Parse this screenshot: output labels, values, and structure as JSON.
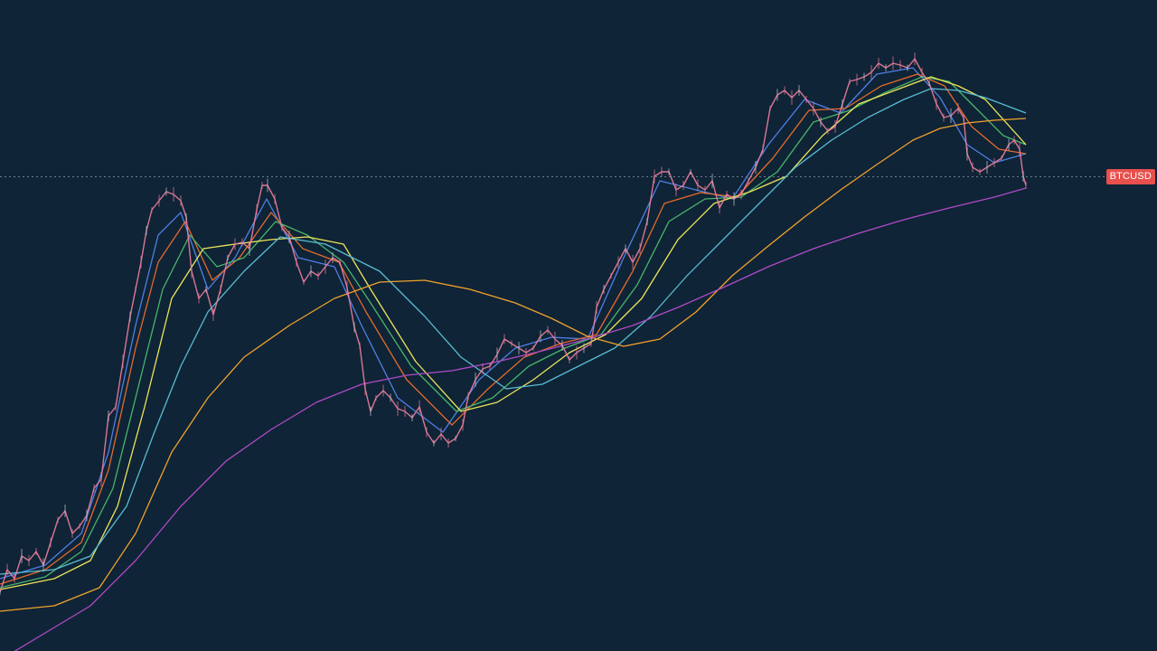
{
  "symbol_label": "BTCUSD",
  "background": "#0f2436",
  "price_line_color": "#6b7d8c",
  "label_color": "#e8504d",
  "chart_data": {
    "type": "line",
    "grid": false,
    "legend": "none",
    "price_color": "#ef7fa0",
    "price": [
      [
        0,
        655
      ],
      [
        8,
        630
      ],
      [
        16,
        640
      ],
      [
        24,
        615
      ],
      [
        32,
        620
      ],
      [
        40,
        610
      ],
      [
        48,
        625
      ],
      [
        56,
        600
      ],
      [
        64,
        575
      ],
      [
        72,
        565
      ],
      [
        80,
        590
      ],
      [
        88,
        582
      ],
      [
        96,
        570
      ],
      [
        104,
        540
      ],
      [
        112,
        530
      ],
      [
        120,
        460
      ],
      [
        128,
        450
      ],
      [
        136,
        400
      ],
      [
        144,
        350
      ],
      [
        150,
        320
      ],
      [
        156,
        290
      ],
      [
        162,
        255
      ],
      [
        168,
        232
      ],
      [
        176,
        222
      ],
      [
        184,
        212
      ],
      [
        192,
        215
      ],
      [
        200,
        222
      ],
      [
        206,
        240
      ],
      [
        212,
        300
      ],
      [
        220,
        330
      ],
      [
        228,
        320
      ],
      [
        236,
        348
      ],
      [
        244,
        320
      ],
      [
        252,
        285
      ],
      [
        260,
        270
      ],
      [
        268,
        268
      ],
      [
        276,
        275
      ],
      [
        284,
        232
      ],
      [
        290,
        205
      ],
      [
        296,
        205
      ],
      [
        304,
        220
      ],
      [
        312,
        252
      ],
      [
        320,
        262
      ],
      [
        328,
        290
      ],
      [
        336,
        312
      ],
      [
        344,
        300
      ],
      [
        352,
        305
      ],
      [
        360,
        295
      ],
      [
        368,
        285
      ],
      [
        376,
        290
      ],
      [
        384,
        318
      ],
      [
        392,
        362
      ],
      [
        398,
        382
      ],
      [
        404,
        430
      ],
      [
        410,
        455
      ],
      [
        416,
        440
      ],
      [
        424,
        432
      ],
      [
        432,
        440
      ],
      [
        440,
        452
      ],
      [
        448,
        455
      ],
      [
        456,
        462
      ],
      [
        464,
        450
      ],
      [
        472,
        478
      ],
      [
        480,
        490
      ],
      [
        488,
        480
      ],
      [
        496,
        490
      ],
      [
        504,
        485
      ],
      [
        512,
        470
      ],
      [
        518,
        438
      ],
      [
        526,
        420
      ],
      [
        534,
        408
      ],
      [
        542,
        405
      ],
      [
        550,
        392
      ],
      [
        558,
        375
      ],
      [
        566,
        380
      ],
      [
        574,
        385
      ],
      [
        582,
        390
      ],
      [
        590,
        385
      ],
      [
        598,
        372
      ],
      [
        606,
        365
      ],
      [
        614,
        375
      ],
      [
        622,
        382
      ],
      [
        630,
        398
      ],
      [
        638,
        390
      ],
      [
        646,
        385
      ],
      [
        654,
        380
      ],
      [
        660,
        340
      ],
      [
        668,
        320
      ],
      [
        676,
        305
      ],
      [
        684,
        290
      ],
      [
        692,
        275
      ],
      [
        700,
        290
      ],
      [
        708,
        275
      ],
      [
        716,
        245
      ],
      [
        724,
        195
      ],
      [
        732,
        190
      ],
      [
        740,
        190
      ],
      [
        748,
        210
      ],
      [
        756,
        205
      ],
      [
        764,
        190
      ],
      [
        772,
        205
      ],
      [
        780,
        210
      ],
      [
        788,
        200
      ],
      [
        796,
        230
      ],
      [
        804,
        215
      ],
      [
        812,
        220
      ],
      [
        820,
        215
      ],
      [
        828,
        200
      ],
      [
        836,
        185
      ],
      [
        844,
        165
      ],
      [
        852,
        120
      ],
      [
        860,
        105
      ],
      [
        868,
        100
      ],
      [
        876,
        108
      ],
      [
        884,
        100
      ],
      [
        892,
        110
      ],
      [
        900,
        120
      ],
      [
        908,
        135
      ],
      [
        916,
        145
      ],
      [
        924,
        140
      ],
      [
        932,
        115
      ],
      [
        940,
        90
      ],
      [
        948,
        88
      ],
      [
        956,
        85
      ],
      [
        964,
        80
      ],
      [
        972,
        70
      ],
      [
        980,
        75
      ],
      [
        988,
        70
      ],
      [
        996,
        72
      ],
      [
        1004,
        75
      ],
      [
        1012,
        65
      ],
      [
        1020,
        80
      ],
      [
        1028,
        92
      ],
      [
        1036,
        115
      ],
      [
        1044,
        130
      ],
      [
        1052,
        128
      ],
      [
        1060,
        120
      ],
      [
        1066,
        130
      ],
      [
        1070,
        170
      ],
      [
        1076,
        185
      ],
      [
        1084,
        190
      ],
      [
        1092,
        185
      ],
      [
        1100,
        180
      ],
      [
        1108,
        175
      ],
      [
        1116,
        160
      ],
      [
        1122,
        155
      ],
      [
        1128,
        165
      ],
      [
        1132,
        195
      ],
      [
        1135,
        205
      ]
    ],
    "moving_averages": [
      {
        "color": "#4f7fe6",
        "points": [
          [
            0,
            640
          ],
          [
            50,
            625
          ],
          [
            90,
            590
          ],
          [
            120,
            500
          ],
          [
            150,
            360
          ],
          [
            175,
            260
          ],
          [
            200,
            235
          ],
          [
            230,
            320
          ],
          [
            260,
            285
          ],
          [
            295,
            220
          ],
          [
            330,
            285
          ],
          [
            370,
            295
          ],
          [
            400,
            360
          ],
          [
            440,
            440
          ],
          [
            490,
            478
          ],
          [
            530,
            420
          ],
          [
            570,
            385
          ],
          [
            610,
            373
          ],
          [
            650,
            375
          ],
          [
            690,
            285
          ],
          [
            730,
            200
          ],
          [
            770,
            210
          ],
          [
            810,
            220
          ],
          [
            850,
            160
          ],
          [
            890,
            110
          ],
          [
            930,
            125
          ],
          [
            970,
            82
          ],
          [
            1010,
            75
          ],
          [
            1040,
            108
          ],
          [
            1070,
            160
          ],
          [
            1100,
            180
          ],
          [
            1135,
            170
          ]
        ]
      },
      {
        "color": "#e56a2c",
        "points": [
          [
            0,
            646
          ],
          [
            50,
            630
          ],
          [
            90,
            600
          ],
          [
            120,
            520
          ],
          [
            150,
            385
          ],
          [
            175,
            290
          ],
          [
            205,
            245
          ],
          [
            235,
            310
          ],
          [
            265,
            285
          ],
          [
            300,
            235
          ],
          [
            335,
            275
          ],
          [
            375,
            290
          ],
          [
            405,
            345
          ],
          [
            450,
            420
          ],
          [
            500,
            470
          ],
          [
            540,
            430
          ],
          [
            580,
            395
          ],
          [
            620,
            380
          ],
          [
            660,
            370
          ],
          [
            700,
            300
          ],
          [
            735,
            225
          ],
          [
            775,
            213
          ],
          [
            815,
            218
          ],
          [
            855,
            175
          ],
          [
            895,
            122
          ],
          [
            935,
            120
          ],
          [
            975,
            95
          ],
          [
            1015,
            82
          ],
          [
            1045,
            95
          ],
          [
            1075,
            140
          ],
          [
            1105,
            165
          ],
          [
            1135,
            170
          ]
        ]
      },
      {
        "color": "#4ab56a",
        "points": [
          [
            0,
            650
          ],
          [
            50,
            638
          ],
          [
            90,
            610
          ],
          [
            125,
            540
          ],
          [
            155,
            420
          ],
          [
            180,
            320
          ],
          [
            210,
            260
          ],
          [
            240,
            295
          ],
          [
            270,
            285
          ],
          [
            305,
            245
          ],
          [
            340,
            260
          ],
          [
            380,
            290
          ],
          [
            410,
            335
          ],
          [
            455,
            405
          ],
          [
            505,
            455
          ],
          [
            545,
            440
          ],
          [
            585,
            405
          ],
          [
            625,
            385
          ],
          [
            665,
            370
          ],
          [
            705,
            315
          ],
          [
            740,
            245
          ],
          [
            780,
            220
          ],
          [
            820,
            218
          ],
          [
            860,
            190
          ],
          [
            900,
            135
          ],
          [
            940,
            122
          ],
          [
            980,
            102
          ],
          [
            1020,
            85
          ],
          [
            1050,
            90
          ],
          [
            1080,
            120
          ],
          [
            1110,
            150
          ],
          [
            1135,
            160
          ]
        ]
      },
      {
        "color": "#ece55a",
        "points": [
          [
            0,
            652
          ],
          [
            60,
            640
          ],
          [
            100,
            620
          ],
          [
            130,
            560
          ],
          [
            160,
            450
          ],
          [
            190,
            330
          ],
          [
            225,
            275
          ],
          [
            260,
            270
          ],
          [
            300,
            265
          ],
          [
            340,
            262
          ],
          [
            380,
            270
          ],
          [
            410,
            320
          ],
          [
            460,
            400
          ],
          [
            510,
            455
          ],
          [
            550,
            445
          ],
          [
            590,
            420
          ],
          [
            630,
            390
          ],
          [
            670,
            370
          ],
          [
            710,
            330
          ],
          [
            750,
            265
          ],
          [
            790,
            225
          ],
          [
            830,
            212
          ],
          [
            870,
            195
          ],
          [
            910,
            150
          ],
          [
            950,
            115
          ],
          [
            990,
            100
          ],
          [
            1030,
            85
          ],
          [
            1060,
            95
          ],
          [
            1090,
            110
          ],
          [
            1135,
            160
          ]
        ]
      },
      {
        "color": "#58bcd3",
        "points": [
          [
            0,
            635
          ],
          [
            60,
            630
          ],
          [
            100,
            615
          ],
          [
            140,
            560
          ],
          [
            170,
            480
          ],
          [
            200,
            405
          ],
          [
            230,
            345
          ],
          [
            270,
            300
          ],
          [
            310,
            262
          ],
          [
            360,
            270
          ],
          [
            420,
            300
          ],
          [
            470,
            350
          ],
          [
            510,
            395
          ],
          [
            560,
            430
          ],
          [
            600,
            425
          ],
          [
            640,
            405
          ],
          [
            680,
            385
          ],
          [
            720,
            350
          ],
          [
            760,
            305
          ],
          [
            800,
            265
          ],
          [
            840,
            225
          ],
          [
            880,
            185
          ],
          [
            920,
            155
          ],
          [
            960,
            130
          ],
          [
            1000,
            110
          ],
          [
            1030,
            98
          ],
          [
            1060,
            100
          ],
          [
            1090,
            108
          ],
          [
            1135,
            125
          ]
        ]
      },
      {
        "color": "#f2a12e",
        "points": [
          [
            0,
            676
          ],
          [
            60,
            670
          ],
          [
            110,
            650
          ],
          [
            150,
            590
          ],
          [
            190,
            500
          ],
          [
            230,
            440
          ],
          [
            270,
            395
          ],
          [
            320,
            360
          ],
          [
            370,
            330
          ],
          [
            420,
            312
          ],
          [
            470,
            310
          ],
          [
            520,
            320
          ],
          [
            570,
            335
          ],
          [
            610,
            352
          ],
          [
            650,
            372
          ],
          [
            690,
            383
          ],
          [
            730,
            375
          ],
          [
            770,
            345
          ],
          [
            810,
            305
          ],
          [
            850,
            272
          ],
          [
            890,
            240
          ],
          [
            930,
            210
          ],
          [
            970,
            182
          ],
          [
            1010,
            155
          ],
          [
            1040,
            142
          ],
          [
            1070,
            136
          ],
          [
            1100,
            133
          ],
          [
            1135,
            131
          ]
        ]
      },
      {
        "color": "#b04ac8",
        "points": [
          [
            0,
            730
          ],
          [
            50,
            700
          ],
          [
            100,
            670
          ],
          [
            150,
            620
          ],
          [
            200,
            560
          ],
          [
            250,
            510
          ],
          [
            300,
            475
          ],
          [
            350,
            445
          ],
          [
            400,
            425
          ],
          [
            450,
            415
          ],
          [
            500,
            410
          ],
          [
            550,
            400
          ],
          [
            600,
            388
          ],
          [
            650,
            375
          ],
          [
            700,
            360
          ],
          [
            750,
            340
          ],
          [
            800,
            318
          ],
          [
            850,
            295
          ],
          [
            900,
            275
          ],
          [
            950,
            258
          ],
          [
            1000,
            243
          ],
          [
            1050,
            230
          ],
          [
            1100,
            218
          ],
          [
            1135,
            208
          ]
        ]
      }
    ]
  }
}
